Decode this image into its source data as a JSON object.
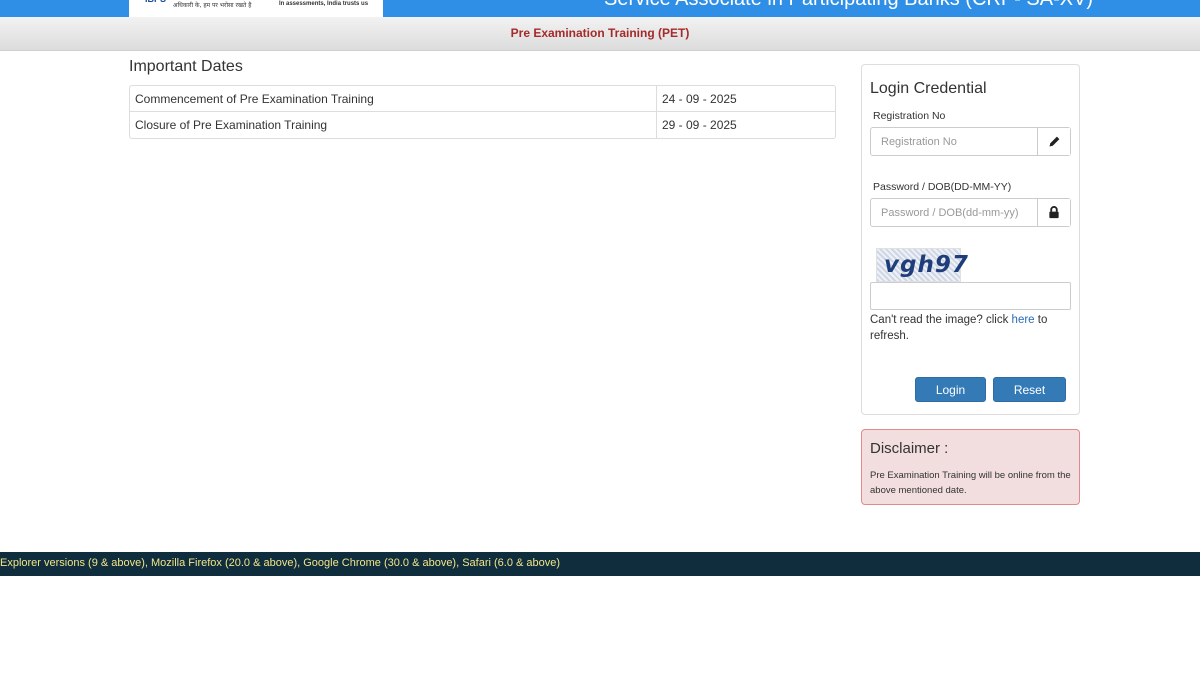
{
  "header": {
    "logo_text_hindi": "अधिकारी के, हम पर भरोसा रखते है",
    "logo_text_english": "In assessments, India trusts us",
    "title": "Service Associate in Participating Banks (CRP- SA-XV)"
  },
  "subheader": {
    "title": "Pre Examination Training (PET)"
  },
  "important_dates": {
    "heading": "Important Dates",
    "rows": [
      {
        "label": "Commencement of Pre Examination Training",
        "value": "24 - 09 - 2025"
      },
      {
        "label": "Closure of Pre Examination Training",
        "value": "29 - 09 - 2025"
      }
    ]
  },
  "login": {
    "title": "Login Credential",
    "registration_label": "Registration No",
    "registration_placeholder": "Registration No",
    "password_label": "Password / DOB(DD-MM-YY)",
    "password_placeholder": "Password / DOB(dd-mm-yy)",
    "captcha_text": "vgh97",
    "captcha_help_prefix": "Can't read the image? click ",
    "captcha_help_link": "here",
    "captcha_help_suffix": " to refresh.",
    "login_button": "Login",
    "reset_button": "Reset",
    "icons": {
      "registration": "pencil-icon",
      "password": "lock-icon"
    },
    "button_color": "#337ab7"
  },
  "disclaimer": {
    "title": "Disclaimer :",
    "text": "Pre Examination Training will be online from the above mentioned date.",
    "background": "#f2dede"
  },
  "footer": {
    "text": "Explorer versions (9 & above), Mozilla Firefox (20.0 & above), Google Chrome (30.0 & above), Safari (6.0 & above)"
  },
  "colors": {
    "header_blue": "#2f8fe6",
    "subheader_title": "#a52a2a",
    "footer_bg": "#0f2d3c",
    "footer_text": "#f2e58a"
  }
}
